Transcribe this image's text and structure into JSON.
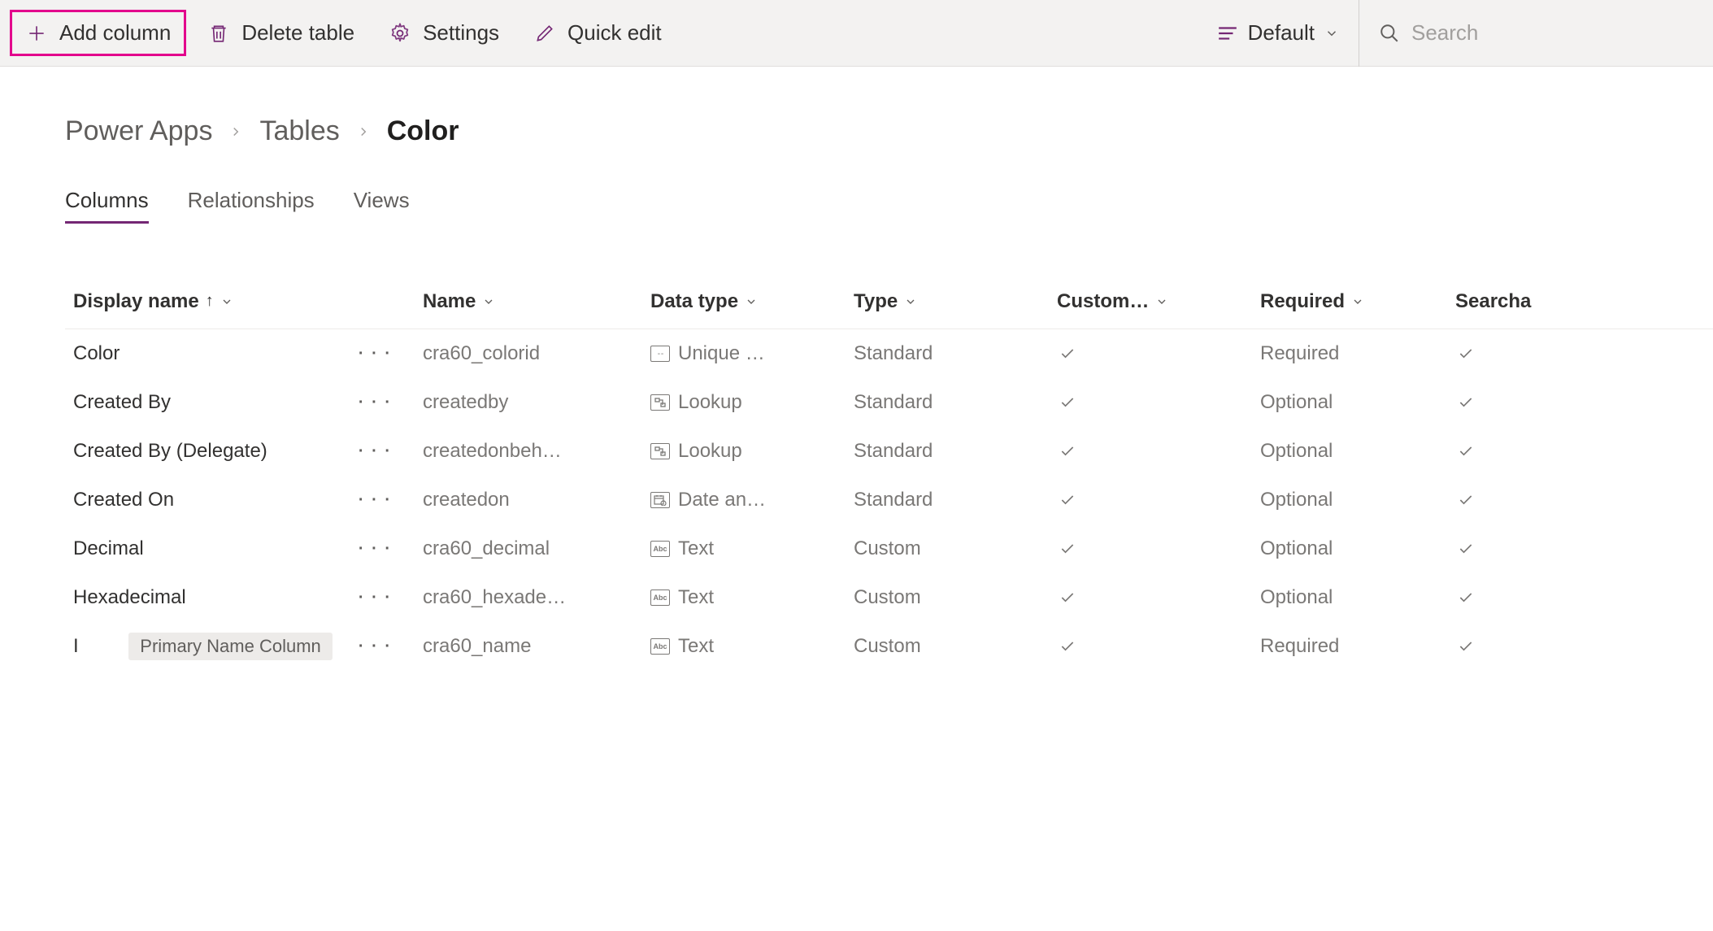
{
  "toolbar": {
    "add_column": "Add column",
    "delete_table": "Delete table",
    "settings": "Settings",
    "quick_edit": "Quick edit",
    "view_label": "Default"
  },
  "search": {
    "placeholder": "Search"
  },
  "breadcrumb": {
    "root": "Power Apps",
    "section": "Tables",
    "current": "Color"
  },
  "tabs": {
    "columns": "Columns",
    "relationships": "Relationships",
    "views": "Views"
  },
  "headers": {
    "display_name": "Display name",
    "name": "Name",
    "data_type": "Data type",
    "type": "Type",
    "custom": "Custom…",
    "required": "Required",
    "searchable": "Searcha"
  },
  "rows": [
    {
      "display": "Color",
      "name": "cra60_colorid",
      "datatype": "Unique …",
      "dticon": "unique",
      "type": "Standard",
      "custom": true,
      "required": "Required",
      "searchable": true,
      "pill": ""
    },
    {
      "display": "Created By",
      "name": "createdby",
      "datatype": "Lookup",
      "dticon": "lookup",
      "type": "Standard",
      "custom": true,
      "required": "Optional",
      "searchable": true,
      "pill": ""
    },
    {
      "display": "Created By (Delegate)",
      "name": "createdonbeh…",
      "datatype": "Lookup",
      "dticon": "lookup",
      "type": "Standard",
      "custom": true,
      "required": "Optional",
      "searchable": true,
      "pill": ""
    },
    {
      "display": "Created On",
      "name": "createdon",
      "datatype": "Date an…",
      "dticon": "date",
      "type": "Standard",
      "custom": true,
      "required": "Optional",
      "searchable": true,
      "pill": ""
    },
    {
      "display": "Decimal",
      "name": "cra60_decimal",
      "datatype": "Text",
      "dticon": "text",
      "type": "Custom",
      "custom": true,
      "required": "Optional",
      "searchable": true,
      "pill": ""
    },
    {
      "display": "Hexadecimal",
      "name": "cra60_hexade…",
      "datatype": "Text",
      "dticon": "text",
      "type": "Custom",
      "custom": true,
      "required": "Optional",
      "searchable": true,
      "pill": ""
    },
    {
      "display": "",
      "name": "cra60_name",
      "datatype": "Text",
      "dticon": "text",
      "type": "Custom",
      "custom": true,
      "required": "Required",
      "searchable": true,
      "pill": "Primary Name Column"
    }
  ]
}
